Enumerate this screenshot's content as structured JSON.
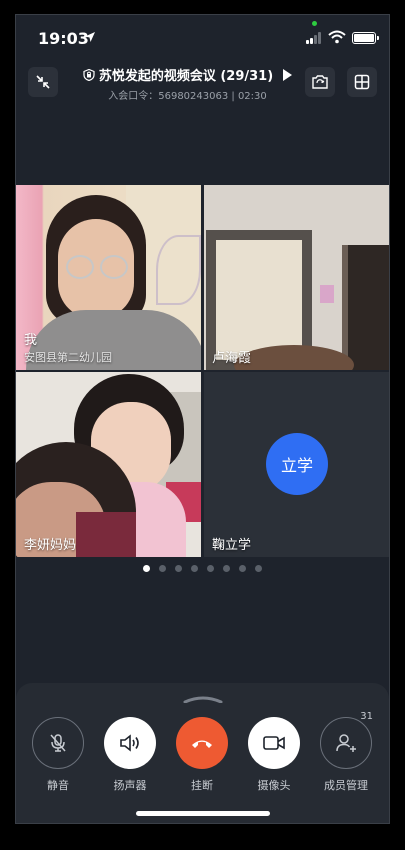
{
  "status_bar": {
    "time": "19:03",
    "location_icon": "location-arrow-icon"
  },
  "header": {
    "title": "苏悦发起的视频会议 (29/31)",
    "subtitle": "入会口令：56980243063 | 02:30",
    "icons": [
      "shrink-icon",
      "lock-icon",
      "play-icon",
      "flip-camera-icon",
      "grid-view-icon"
    ]
  },
  "participants": [
    {
      "name": "我",
      "org": "安图县第二幼儿园"
    },
    {
      "name": "卢海霞"
    },
    {
      "name": "李妍妈妈"
    },
    {
      "name": "鞠立学",
      "avatar_text": "立学",
      "avatar_color": "#2f6ef3"
    }
  ],
  "pagination": {
    "total": 8,
    "active": 1
  },
  "controls": [
    {
      "label": "静音",
      "icon": "microphone-muted-icon"
    },
    {
      "label": "扬声器",
      "icon": "speaker-icon"
    },
    {
      "label": "挂断",
      "icon": "hang-up-icon",
      "color": "#ee5a32"
    },
    {
      "label": "摄像头",
      "icon": "camera-icon"
    },
    {
      "label": "成员管理",
      "icon": "member-management-icon",
      "badge": "31"
    }
  ]
}
